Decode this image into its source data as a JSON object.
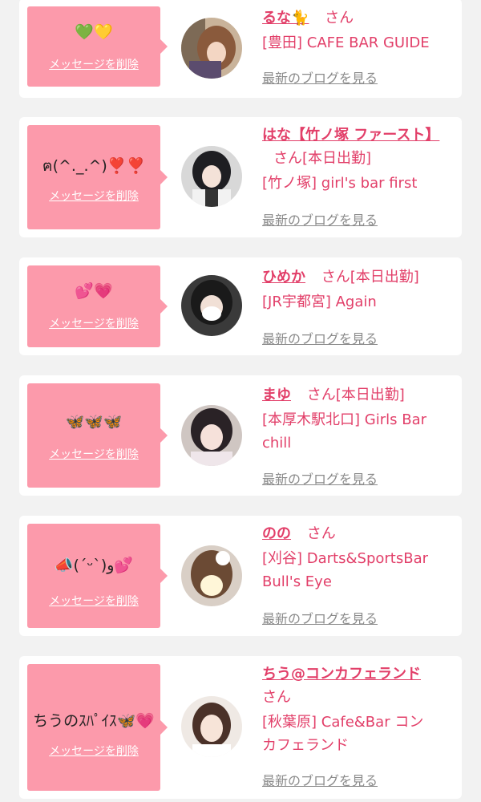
{
  "common": {
    "delete_label": "メッセージを削除",
    "blog_label": "最新のブログを見る",
    "san": "さん"
  },
  "colors": {
    "page_bg": "#f2f2f2",
    "card_bg": "#ffffff",
    "bubble_pink": "#fc9aab",
    "name_pink": "#e23f69",
    "link_gray": "#8a8a8a"
  },
  "cards": [
    {
      "message_emoji": "💚💛",
      "name": "るな🐈",
      "status": "",
      "shop_line1": "[豊田] CAFE BAR GUIDE",
      "shop_line2": ""
    },
    {
      "message_emoji": "ฅ(^._.^)❣️❣️",
      "name": "はな【竹ノ塚 ファースト】",
      "status": "[本日出勤]",
      "shop_line1": "[竹ノ塚] girl's bar first",
      "shop_line2": ""
    },
    {
      "message_emoji": "💕💗",
      "name": "ひめか",
      "status": "[本日出勤]",
      "shop_line1": "[JR宇都宮] Again",
      "shop_line2": ""
    },
    {
      "message_emoji": "🦋🦋🦋",
      "name": "まゆ",
      "status": "[本日出勤]",
      "shop_line1": "[本厚木駅北口] Girls Bar",
      "shop_line2": "chill"
    },
    {
      "message_emoji": "📣(ˊᵕˋ)و💕",
      "name": "のの",
      "status": "",
      "shop_line1": "[刈谷] Darts&SportsBar",
      "shop_line2": "Bull's Eye"
    },
    {
      "message_emoji": "ちうのｽﾊﾟｲｽ🦋💗",
      "name": "ちう@コンカフェランド",
      "status": "",
      "shop_line1": "[秋葉原] Cafe&Bar コン",
      "shop_line2": "カフェランド"
    }
  ]
}
